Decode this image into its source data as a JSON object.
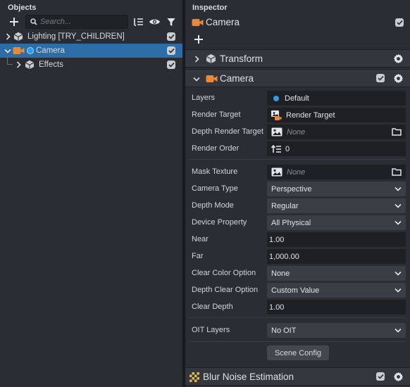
{
  "objects": {
    "title": "Objects",
    "search_placeholder": "Search...",
    "tree": [
      {
        "label": "Lighting [TRY_CHILDREN]",
        "checked": true
      },
      {
        "label": "Camera",
        "checked": true,
        "selected": true
      },
      {
        "label": "Effects",
        "checked": true
      }
    ]
  },
  "inspector": {
    "title": "Inspector",
    "object_name": "Camera",
    "sections": {
      "transform": "Transform",
      "camera": "Camera",
      "blur": "Blur Noise Estimation"
    },
    "properties": {
      "layers": {
        "label": "Layers",
        "value": "Default"
      },
      "render_target": {
        "label": "Render Target",
        "value": "Render Target"
      },
      "depth_render_target": {
        "label": "Depth Render Target",
        "value": "None"
      },
      "render_order": {
        "label": "Render Order",
        "value": "0"
      },
      "mask_texture": {
        "label": "Mask Texture",
        "value": "None"
      },
      "camera_type": {
        "label": "Camera Type",
        "value": "Perspective"
      },
      "depth_mode": {
        "label": "Depth Mode",
        "value": "Regular"
      },
      "device_property": {
        "label": "Device Property",
        "value": "All Physical"
      },
      "near": {
        "label": "Near",
        "value": "1.00"
      },
      "far": {
        "label": "Far",
        "value": "1,000.00"
      },
      "clear_color_option": {
        "label": "Clear Color Option",
        "value": "None"
      },
      "depth_clear_option": {
        "label": "Depth Clear Option",
        "value": "Custom Value"
      },
      "clear_depth": {
        "label": "Clear Depth",
        "value": "1.00"
      },
      "oit_layers": {
        "label": "OIT Layers",
        "value": "No OIT"
      }
    },
    "scene_config_button": "Scene Config"
  },
  "colors": {
    "selection": "#2b6da7",
    "camera_orange": "#e8893a",
    "layer_dot": "#2f9cf0",
    "panel_bg": "#2a2d33"
  }
}
